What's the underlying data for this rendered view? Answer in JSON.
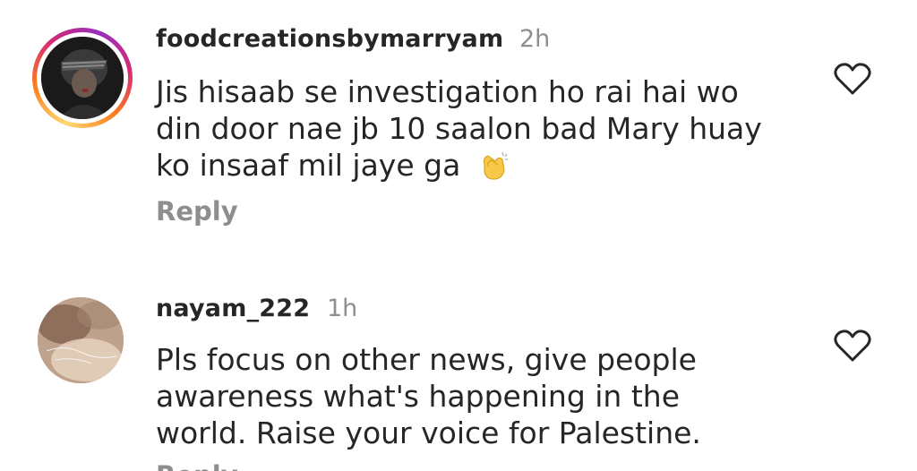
{
  "comments": [
    {
      "username": "foodcreationsbymarryam",
      "time": "2h",
      "lines": [
        "Jis hisaab se investigation ho rai hai wo",
        "din door nae jb 10 saalon bad Mary huay",
        "ko insaaf mil jaye ga"
      ],
      "emoji": "clapping-hands",
      "reply_label": "Reply",
      "has_story_ring": true
    },
    {
      "username": "nayam_222",
      "time": "1h",
      "lines": [
        "Pls focus on other news, give people",
        "awareness what's happening in the",
        "world. Raise your voice for Palestine."
      ],
      "reply_label": "Reply",
      "has_story_ring": false
    }
  ],
  "colors": {
    "text": "#262626",
    "muted": "#8e8e8e",
    "background": "#ffffff"
  }
}
